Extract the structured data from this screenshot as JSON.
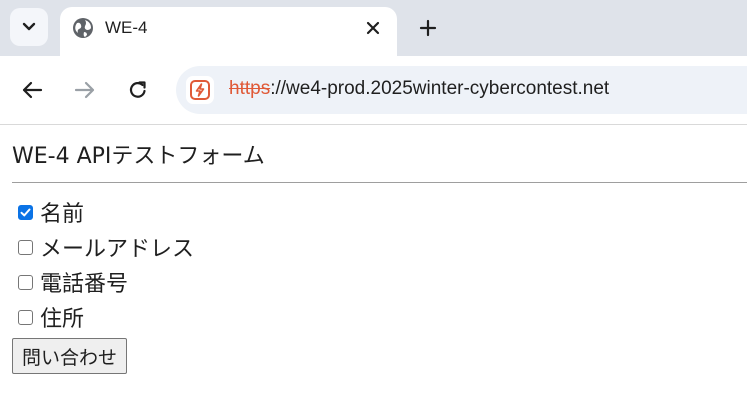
{
  "browser": {
    "tab": {
      "title": "WE-4"
    },
    "address_bar": {
      "scheme": "https",
      "rest": "://we4-prod.2025winter-cybercontest.net"
    }
  },
  "page": {
    "title": "WE-4 APIテストフォーム",
    "options": [
      {
        "label": "名前",
        "checked": true
      },
      {
        "label": "メールアドレス",
        "checked": false
      },
      {
        "label": "電話番号",
        "checked": false
      },
      {
        "label": "住所",
        "checked": false
      }
    ],
    "submit_label": "問い合わせ"
  },
  "colors": {
    "accent": "#0b73e6",
    "insecure_scheme": "#e05a38"
  }
}
